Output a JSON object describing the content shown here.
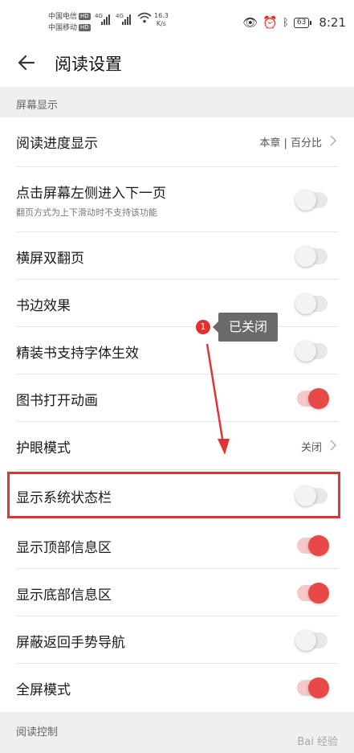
{
  "status_bar": {
    "carrier1": "中国电信",
    "carrier2": "中国移动",
    "hd": "HD",
    "net1": "4G",
    "net2": "4G",
    "speed_value": "16.3",
    "speed_unit": "K/s",
    "battery": "63",
    "time": "8:21"
  },
  "header": {
    "title": "阅读设置"
  },
  "sections": {
    "screen": "屏幕显示",
    "control": "阅读控制"
  },
  "rows": [
    {
      "label": "阅读进度显示",
      "value": "本章 | 百分比",
      "type": "nav"
    },
    {
      "label": "点击屏幕左侧进入下一页",
      "sub": "翻页方式为上下滑动时不支持该功能",
      "type": "toggle",
      "on": false
    },
    {
      "label": "横屏双翻页",
      "type": "toggle",
      "on": false
    },
    {
      "label": "书边效果",
      "type": "toggle",
      "on": false
    },
    {
      "label": "精装书支持字体生效",
      "type": "toggle",
      "on": false
    },
    {
      "label": "图书打开动画",
      "type": "toggle",
      "on": true
    },
    {
      "label": "护眼模式",
      "value": "关闭",
      "type": "nav"
    },
    {
      "label": "显示系统状态栏",
      "type": "toggle",
      "on": false
    },
    {
      "label": "显示顶部信息区",
      "type": "toggle",
      "on": true
    },
    {
      "label": "显示底部信息区",
      "type": "toggle",
      "on": true
    },
    {
      "label": "屏蔽返回手势导航",
      "type": "toggle",
      "on": false
    },
    {
      "label": "全屏模式",
      "type": "toggle",
      "on": true
    }
  ],
  "annotation": {
    "number": "1",
    "text": "已关闭"
  },
  "watermark": "Bai 经验",
  "colors": {
    "accent": "#e84848",
    "highlight": "#e03535"
  }
}
